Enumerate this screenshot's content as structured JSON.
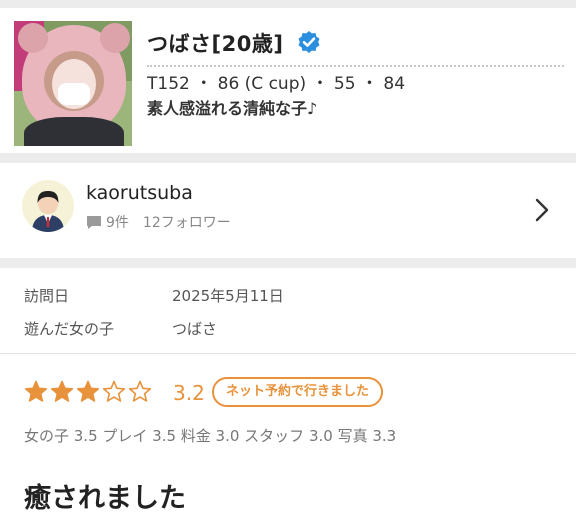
{
  "girl": {
    "name": "つばさ[20歳]",
    "stats": "T152 ・ 86 (C cup) ・ 55 ・ 84",
    "catchphrase": "素人感溢れる清純な子♪"
  },
  "reviewer": {
    "username": "kaorutsuba",
    "review_count": "9件",
    "followers": "12フォロワー"
  },
  "review": {
    "visit_date_label": "訪問日",
    "visit_date": "2025年5月11日",
    "girl_label": "遊んだ女の子",
    "girl_name": "つばさ",
    "rating": "3.2",
    "stars_filled": 3,
    "stars_total": 5,
    "booking_tag": "ネット予約で行きました",
    "subscores": "女の子 3.5 プレイ 3.5 料金 3.0 スタッフ 3.0 写真 3.3",
    "title": "癒されました"
  },
  "colors": {
    "accent": "#e8923b",
    "verified": "#2b8fe0",
    "background": "#ececec"
  }
}
